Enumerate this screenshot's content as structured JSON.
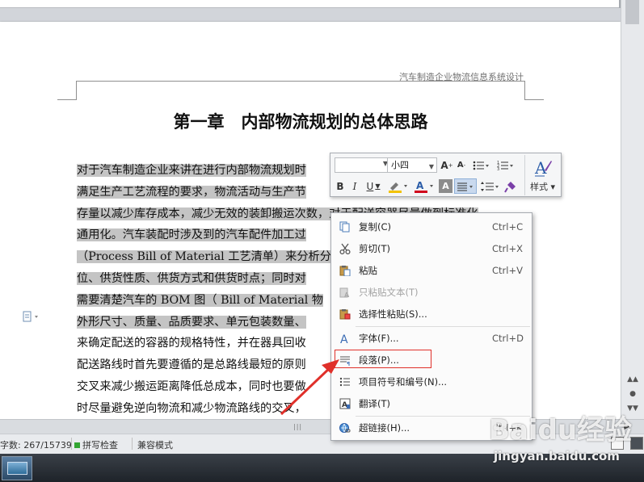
{
  "document": {
    "header_text": "汽车制造企业物流信息系统设计",
    "chapter_title": "第一章　内部物流规划的总体思路",
    "body_lines": [
      {
        "selected": "对于汽车制造企业来讲在进行内部物流规划时",
        "rest": ""
      },
      {
        "selected": "满足生产工艺流程的要求，物流活动与生产节",
        "rest": ""
      },
      {
        "selected": "存量以减少库存成本，减少无效的装卸搬运次数，对于配送容器尽量做到标准化",
        "rest": ""
      },
      {
        "selected": "通用化。汽车装配时涉及到的汽车配件加工过",
        "rest": ""
      },
      {
        "selected": "（Process Bill of Material  工艺清单）来分析分",
        "rest": ""
      },
      {
        "selected": "位、供货性质、供货方式和供货时点；同时对",
        "rest": ""
      },
      {
        "selected": "需要清楚汽车的 BOM 图（  Bill of Material  物",
        "rest": ""
      },
      {
        "selected": "外形尺寸、质量、品质要求、单元包装数量、",
        "rest": ""
      },
      {
        "selected": "",
        "rest": "来确定配送的容器的规格特性，并在器具回收"
      },
      {
        "selected": "",
        "rest": "配送路线时首先要遵循的是总路线最短的原则"
      },
      {
        "selected": "",
        "rest": "交叉来减少搬运距离降低总成本，同时也要做"
      },
      {
        "selected": "",
        "rest": "时尽量避免逆向物流和减少物流路线的交叉，"
      }
    ]
  },
  "mini_toolbar": {
    "font_size": "小四",
    "style_label": "样式",
    "colors": {
      "highlight": "#f2c200",
      "font_color": "#d0021b",
      "text_effect": "#7a3fa8"
    }
  },
  "context_menu": {
    "items": [
      {
        "icon": "copy-icon",
        "label": "复制(C)",
        "shortcut": "Ctrl+C",
        "disabled": false
      },
      {
        "icon": "cut-icon",
        "label": "剪切(T)",
        "shortcut": "Ctrl+X",
        "disabled": false
      },
      {
        "icon": "paste-icon",
        "label": "粘贴",
        "shortcut": "Ctrl+V",
        "disabled": false
      },
      {
        "icon": "paste-text-icon",
        "label": "只粘贴文本(T)",
        "shortcut": "",
        "disabled": true
      },
      {
        "icon": "paste-special-icon",
        "label": "选择性粘贴(S)...",
        "shortcut": "",
        "disabled": false
      },
      {
        "icon": "font-icon",
        "label": "字体(F)...",
        "shortcut": "Ctrl+D",
        "disabled": false
      },
      {
        "icon": "paragraph-icon",
        "label": "段落(P)...",
        "shortcut": "",
        "disabled": false
      },
      {
        "icon": "bullets-icon",
        "label": "项目符号和编号(N)...",
        "shortcut": "",
        "disabled": false
      },
      {
        "icon": "translate-icon",
        "label": "翻译(T)",
        "shortcut": "",
        "disabled": false
      },
      {
        "icon": "hyperlink-icon",
        "label": "超链接(H)...",
        "shortcut": "Ctrl+K",
        "disabled": false
      }
    ]
  },
  "status_bar": {
    "word_count": "字数: 267/15739",
    "spell_check": "拼写检查",
    "compat_mode": "兼容模式",
    "spell_color": "#33a532"
  },
  "watermark": {
    "logo": "Baidu经验",
    "url": "jingyan.baidu.com"
  },
  "annotation": {
    "color": "#e0302a"
  }
}
